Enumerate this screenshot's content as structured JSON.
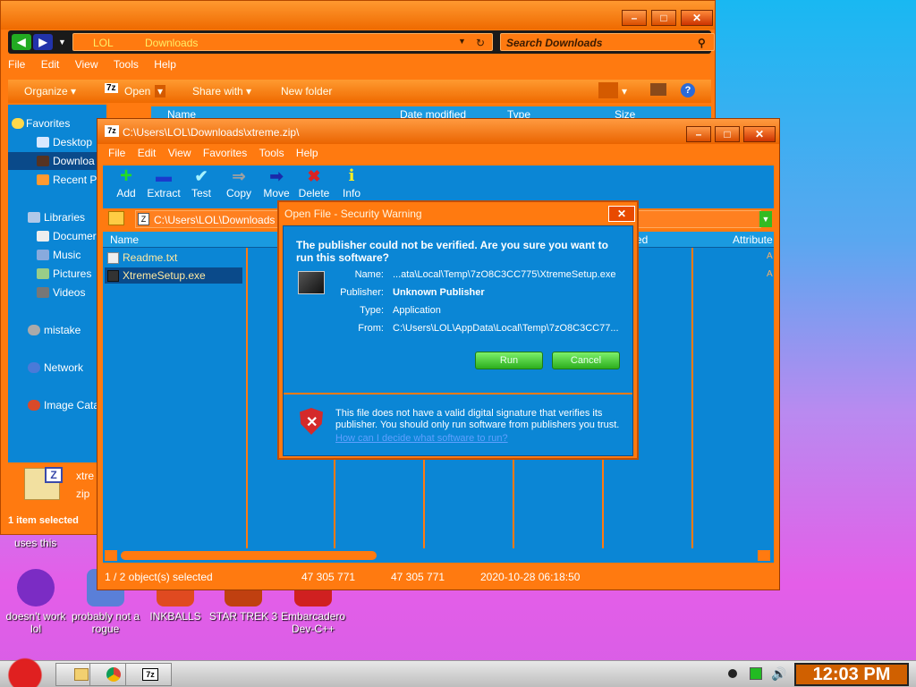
{
  "explorer": {
    "address": {
      "crumb1": "LOL",
      "crumb2": "Downloads"
    },
    "search_placeholder": "Search Downloads",
    "menu": [
      "File",
      "Edit",
      "View",
      "Tools",
      "Help"
    ],
    "toolbar": {
      "organize": "Organize",
      "open": "Open",
      "share": "Share with",
      "new_folder": "New folder"
    },
    "columns": {
      "name": "Name",
      "date": "Date modified",
      "type": "Type",
      "size": "Size"
    },
    "nav": {
      "favorites": "Favorites",
      "desktop": "Desktop",
      "downloads": "Downloa",
      "recent": "Recent P",
      "libraries": "Libraries",
      "documents": "Documer",
      "music": "Music",
      "pictures": "Pictures",
      "videos": "Videos",
      "mistake": "mistake",
      "network": "Network",
      "image_catalog": "Image Cata"
    },
    "details": {
      "name": "xtre",
      "ext": "zip"
    },
    "status": "1 item selected"
  },
  "sevenzip": {
    "title": "C:\\Users\\LOL\\Downloads\\xtreme.zip\\",
    "menu": [
      "File",
      "Edit",
      "View",
      "Favorites",
      "Tools",
      "Help"
    ],
    "tools": [
      {
        "label": "Add",
        "icon": "+",
        "color": "#22dd22"
      },
      {
        "label": "Extract",
        "icon": "—",
        "color": "#1a3acc"
      },
      {
        "label": "Test",
        "icon": "✔",
        "color": "#a6f2ff"
      },
      {
        "label": "Copy",
        "icon": "⇒",
        "color": "#a0a0a0"
      },
      {
        "label": "Move",
        "icon": "➡",
        "color": "#1a2aaa"
      },
      {
        "label": "Delete",
        "icon": "✖",
        "color": "#dd2222"
      },
      {
        "label": "Info",
        "icon": "i",
        "color": "#ffee22"
      }
    ],
    "path": "C:\\Users\\LOL\\Downloads",
    "columns": {
      "name": "Name",
      "modified_suffix": "sed",
      "attributes": "Attribute"
    },
    "files": [
      "Readme.txt",
      "XtremeSetup.exe"
    ],
    "status": {
      "selection": "1 / 2 object(s) selected",
      "size1": "47 305 771",
      "size2": "47 305 771",
      "date": "2020-10-28 06:18:50"
    }
  },
  "dialog": {
    "title": "Open File - Security Warning",
    "question": "The publisher could not be verified.  Are you sure you want to run this software?",
    "fields": [
      {
        "label": "Name:",
        "value": "...ata\\Local\\Temp\\7zO8C3CC775\\XtremeSetup.exe"
      },
      {
        "label": "Publisher:",
        "value": "Unknown Publisher"
      },
      {
        "label": "Type:",
        "value": "Application"
      },
      {
        "label": "From:",
        "value": "C:\\Users\\LOL\\AppData\\Local\\Temp\\7zO8C3CC77..."
      }
    ],
    "run_label": "Run",
    "cancel_label": "Cancel",
    "warning": "This file does not have a valid digital signature that verifies its publisher.  You should only run software from publishers you trust.",
    "help_link": "How can I decide what software to run?"
  },
  "desktop": {
    "partial_label": "uses this",
    "icons": [
      {
        "label": "doesn't work lol",
        "color": "#7b2cc4"
      },
      {
        "label": "probably not a rogue",
        "color": "#5a7fd8"
      },
      {
        "label": "INKBALLS",
        "color": "#e04a20"
      },
      {
        "label": "STAR TREK 3",
        "color": "#c04010"
      },
      {
        "label": "Embarcadero Dev-C++",
        "color": "#d02020"
      }
    ]
  },
  "taskbar": {
    "clock": "12:03 PM"
  },
  "colors": {
    "accent": "#ff7a10",
    "panel": "#0b86d5",
    "run": "#2cae1e"
  }
}
